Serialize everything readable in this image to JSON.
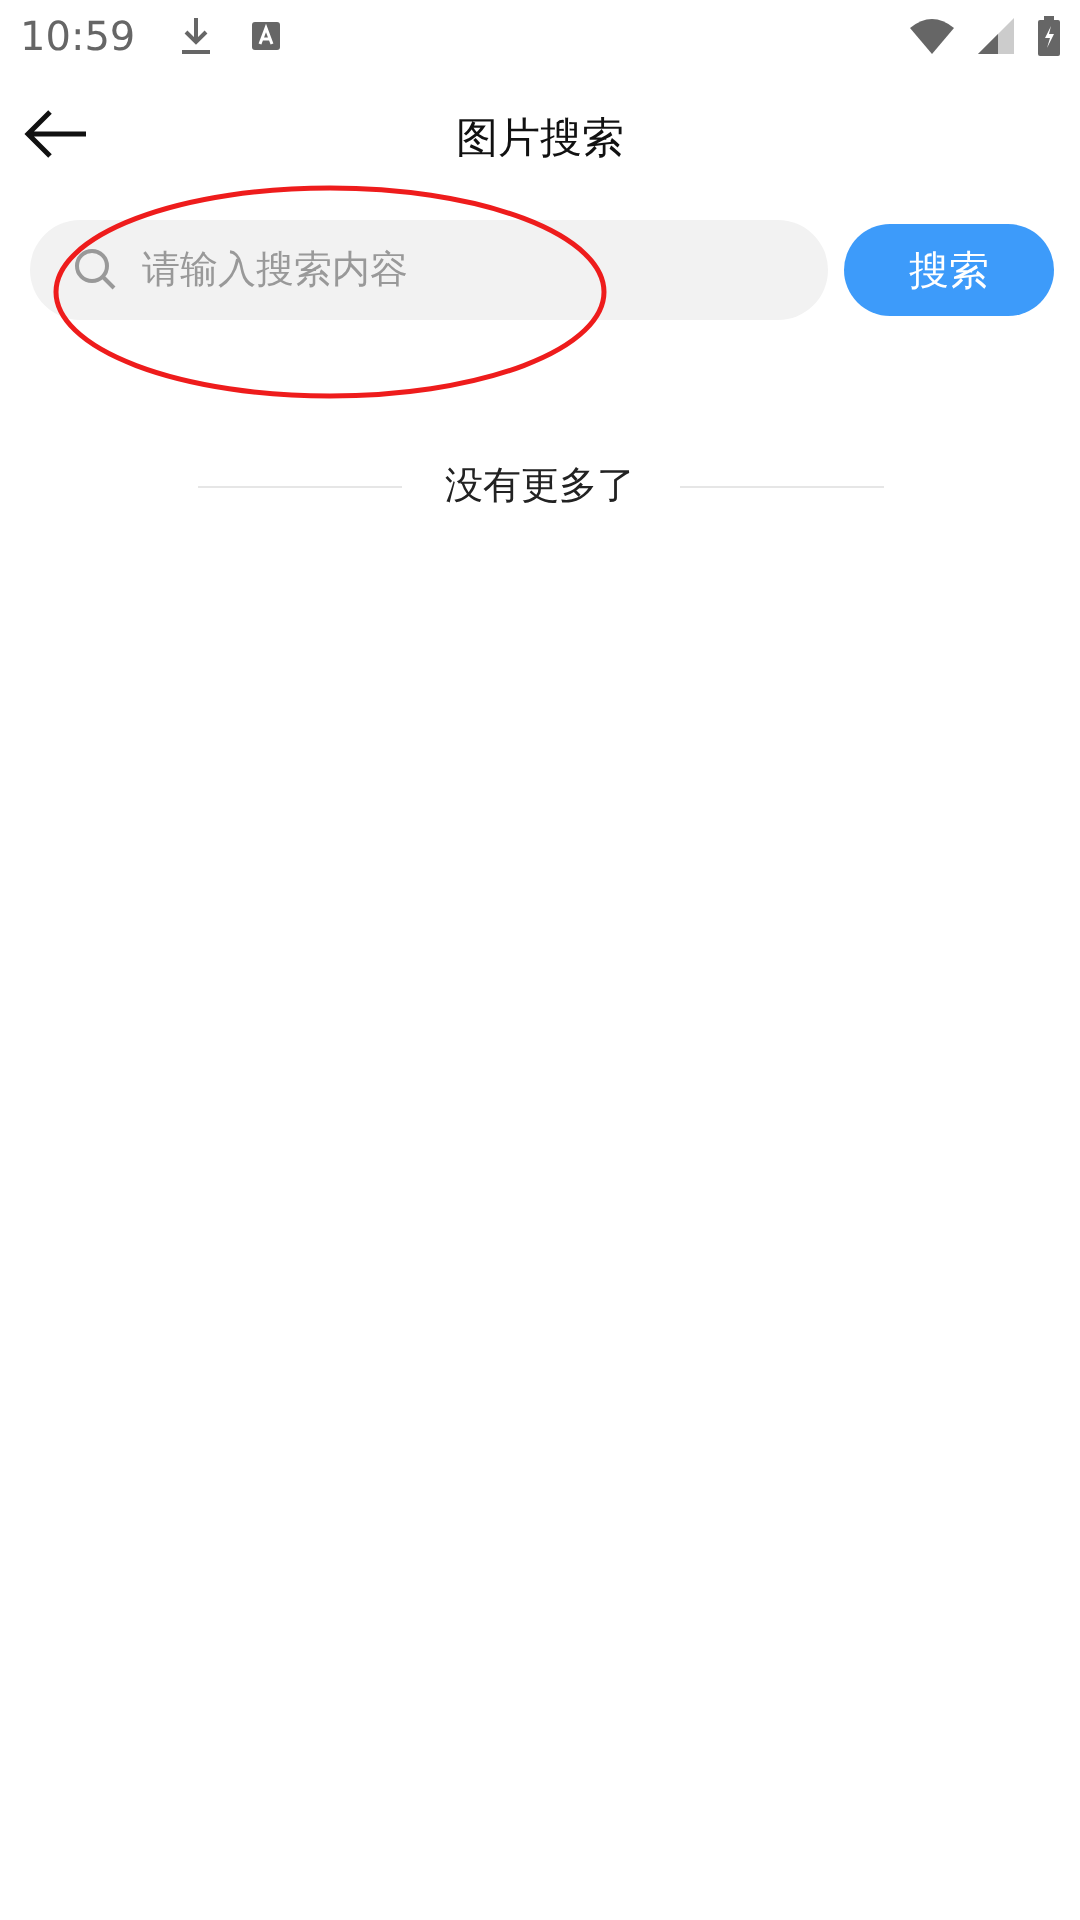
{
  "status_bar": {
    "time": "10:59"
  },
  "header": {
    "title": "图片搜索"
  },
  "search": {
    "placeholder": "请输入搜索内容",
    "button": "搜索"
  },
  "annotation": {
    "kind": "ellipse",
    "color": "#ee1c1c"
  },
  "end_message": "没有更多了"
}
